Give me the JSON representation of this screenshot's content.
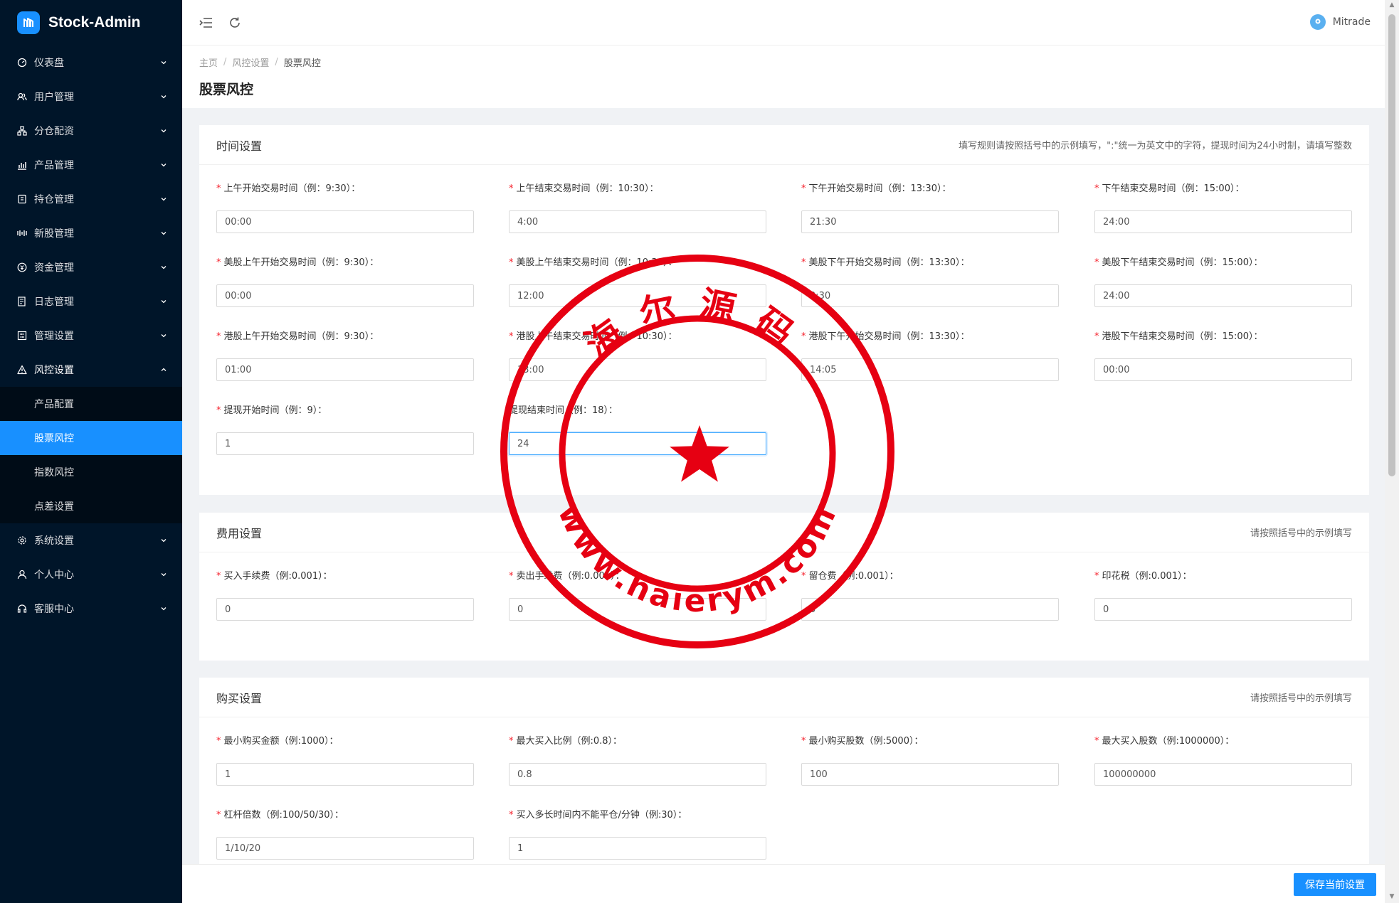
{
  "app": {
    "name": "Stock-Admin"
  },
  "header": {
    "user_name": "Mitrade"
  },
  "sidebar": {
    "items": [
      {
        "label": "仪表盘",
        "icon": "dashboard-icon"
      },
      {
        "label": "用户管理",
        "icon": "user-group-icon"
      },
      {
        "label": "分仓配资",
        "icon": "cluster-icon"
      },
      {
        "label": "产品管理",
        "icon": "chart-icon"
      },
      {
        "label": "持仓管理",
        "icon": "position-icon"
      },
      {
        "label": "新股管理",
        "icon": "new-stock-icon"
      },
      {
        "label": "资金管理",
        "icon": "money-icon"
      },
      {
        "label": "日志管理",
        "icon": "log-icon"
      },
      {
        "label": "管理设置",
        "icon": "admin-settings-icon"
      },
      {
        "label": "风控设置",
        "icon": "warning-icon"
      }
    ],
    "sub_items": [
      "产品配置",
      "股票风控",
      "指数风控",
      "点差设置"
    ],
    "bottom_items": [
      {
        "label": "系统设置",
        "icon": "gear-icon"
      },
      {
        "label": "个人中心",
        "icon": "person-icon"
      },
      {
        "label": "客服中心",
        "icon": "headset-icon"
      }
    ]
  },
  "breadcrumb": {
    "home": "主页",
    "parent": "风控设置",
    "current": "股票风控"
  },
  "page": {
    "title": "股票风控"
  },
  "time_section": {
    "title": "时间设置",
    "hint": "填写规则请按照括号中的示例填写，\":\"统一为英文中的字符，提现时间为24小时制，请填写整数",
    "fields": [
      {
        "label": "上午开始交易时间（例：9:30）：",
        "value": "00:00",
        "required": true
      },
      {
        "label": "上午结束交易时间（例：10:30）：",
        "value": "4:00",
        "required": true
      },
      {
        "label": "下午开始交易时间（例：13:30）：",
        "value": "21:30",
        "required": true
      },
      {
        "label": "下午结束交易时间（例：15:00）：",
        "value": "24:00",
        "required": true
      },
      {
        "label": "美股上午开始交易时间（例：9:30）：",
        "value": "00:00",
        "required": true
      },
      {
        "label": "美股上午结束交易时间（例：10:30）：",
        "value": "12:00",
        "required": true
      },
      {
        "label": "美股下午开始交易时间（例：13:30）：",
        "value": "2:30",
        "required": true
      },
      {
        "label": "美股下午结束交易时间（例：15:00）：",
        "value": "24:00",
        "required": true
      },
      {
        "label": "港股上午开始交易时间（例：9:30）：",
        "value": "01:00",
        "required": true
      },
      {
        "label": "港股上午结束交易时间（例：10:30）：",
        "value": "13:00",
        "required": true
      },
      {
        "label": "港股下午开始交易时间（例：13:30）：",
        "value": "14:05",
        "required": true
      },
      {
        "label": "港股下午结束交易时间（例：15:00）：",
        "value": "00:00",
        "required": true
      },
      {
        "label": "提现开始时间（例：9）：",
        "value": "1",
        "required": true
      },
      {
        "label": "提现结束时间（例：18）：",
        "value": "24",
        "required": false
      }
    ]
  },
  "fee_section": {
    "title": "费用设置",
    "hint": "请按照括号中的示例填写",
    "fields": [
      {
        "label": "买入手续费（例:0.001）：",
        "value": "0",
        "required": true
      },
      {
        "label": "卖出手续费（例:0.001）：",
        "value": "0",
        "required": true
      },
      {
        "label": "留仓费（例:0.001）：",
        "value": "0",
        "required": true
      },
      {
        "label": "印花税（例:0.001）：",
        "value": "0",
        "required": true
      }
    ]
  },
  "buy_section": {
    "title": "购买设置",
    "hint": "请按照括号中的示例填写",
    "fields": [
      {
        "label": "最小购买金额（例:1000）：",
        "value": "1",
        "required": true
      },
      {
        "label": "最大买入比例（例:0.8）：",
        "value": "0.8",
        "required": true
      },
      {
        "label": "最小购买股数（例:5000）：",
        "value": "100",
        "required": true
      },
      {
        "label": "最大买入股数（例:1000000）：",
        "value": "100000000",
        "required": true
      },
      {
        "label": "杠杆倍数（例:100/50/30）：",
        "value": "1/10/20",
        "required": true
      },
      {
        "label": "买入多长时间内不能平仓/分钟（例:30）：",
        "value": "1",
        "required": true
      }
    ]
  },
  "footer": {
    "save_label": "保存当前设置"
  },
  "stamp": {
    "top_text": "海尔源码",
    "bottom_text": "www.haierym.com"
  },
  "colors": {
    "sidebar": "#001529",
    "accent": "#1890ff",
    "stamp": "#e60012"
  }
}
